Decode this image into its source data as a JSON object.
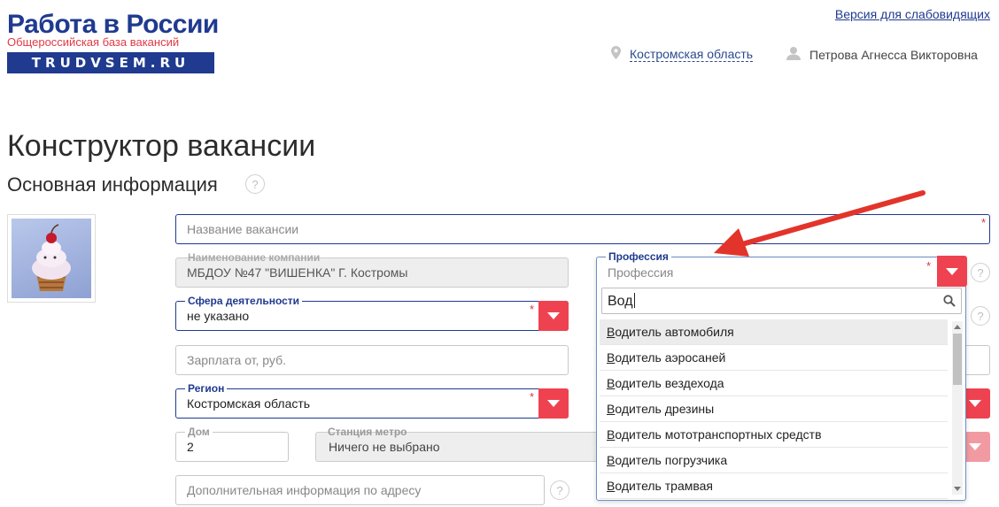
{
  "logo": {
    "title": "Работа в России",
    "subtitle": "Общероссийская база вакансий",
    "band": "TRUDVSEM.RU"
  },
  "header": {
    "accessibility_link": "Версия для слабовидящих",
    "region": "Костромская область",
    "user_name": "Петрова Агнесса Викторовна"
  },
  "page": {
    "title": "Конструктор вакансии",
    "section": "Основная информация",
    "help_glyph": "?"
  },
  "form": {
    "vacancy_name": {
      "placeholder": "Название вакансии",
      "required": "*"
    },
    "company": {
      "label": "Наименование компании",
      "value": "МБДОУ №47 \"ВИШЕНКА\" Г. Костромы"
    },
    "sphere": {
      "label": "Сфера деятельности",
      "value": "не указано",
      "required": "*"
    },
    "salary_from": {
      "placeholder": "Зарплата от, руб."
    },
    "region": {
      "label": "Регион",
      "value": "Костромская область",
      "required": "*"
    },
    "house": {
      "label": "Дом",
      "value": "2"
    },
    "metro": {
      "label": "Станция метро",
      "value": "Ничего не выбрано"
    },
    "address_extra": {
      "placeholder": "Дополнительная информация по адресу"
    }
  },
  "profession_dropdown": {
    "label": "Профессия",
    "current": "Профессия",
    "required": "*",
    "search_query": "Вод",
    "options": [
      {
        "prefix": "В",
        "rest": "одитель автомобиля"
      },
      {
        "prefix": "В",
        "rest": "одитель аэросаней"
      },
      {
        "prefix": "В",
        "rest": "одитель вездехода"
      },
      {
        "prefix": "В",
        "rest": "одитель дрезины"
      },
      {
        "prefix": "В",
        "rest": "одитель мототранспортных средств"
      },
      {
        "prefix": "В",
        "rest": "одитель погрузчика"
      },
      {
        "prefix": "В",
        "rest": "одитель трамвая"
      }
    ]
  },
  "colors": {
    "brand_blue": "#1f3a8f",
    "accent_red": "#ef4250",
    "arrow_red": "#e2342a"
  }
}
